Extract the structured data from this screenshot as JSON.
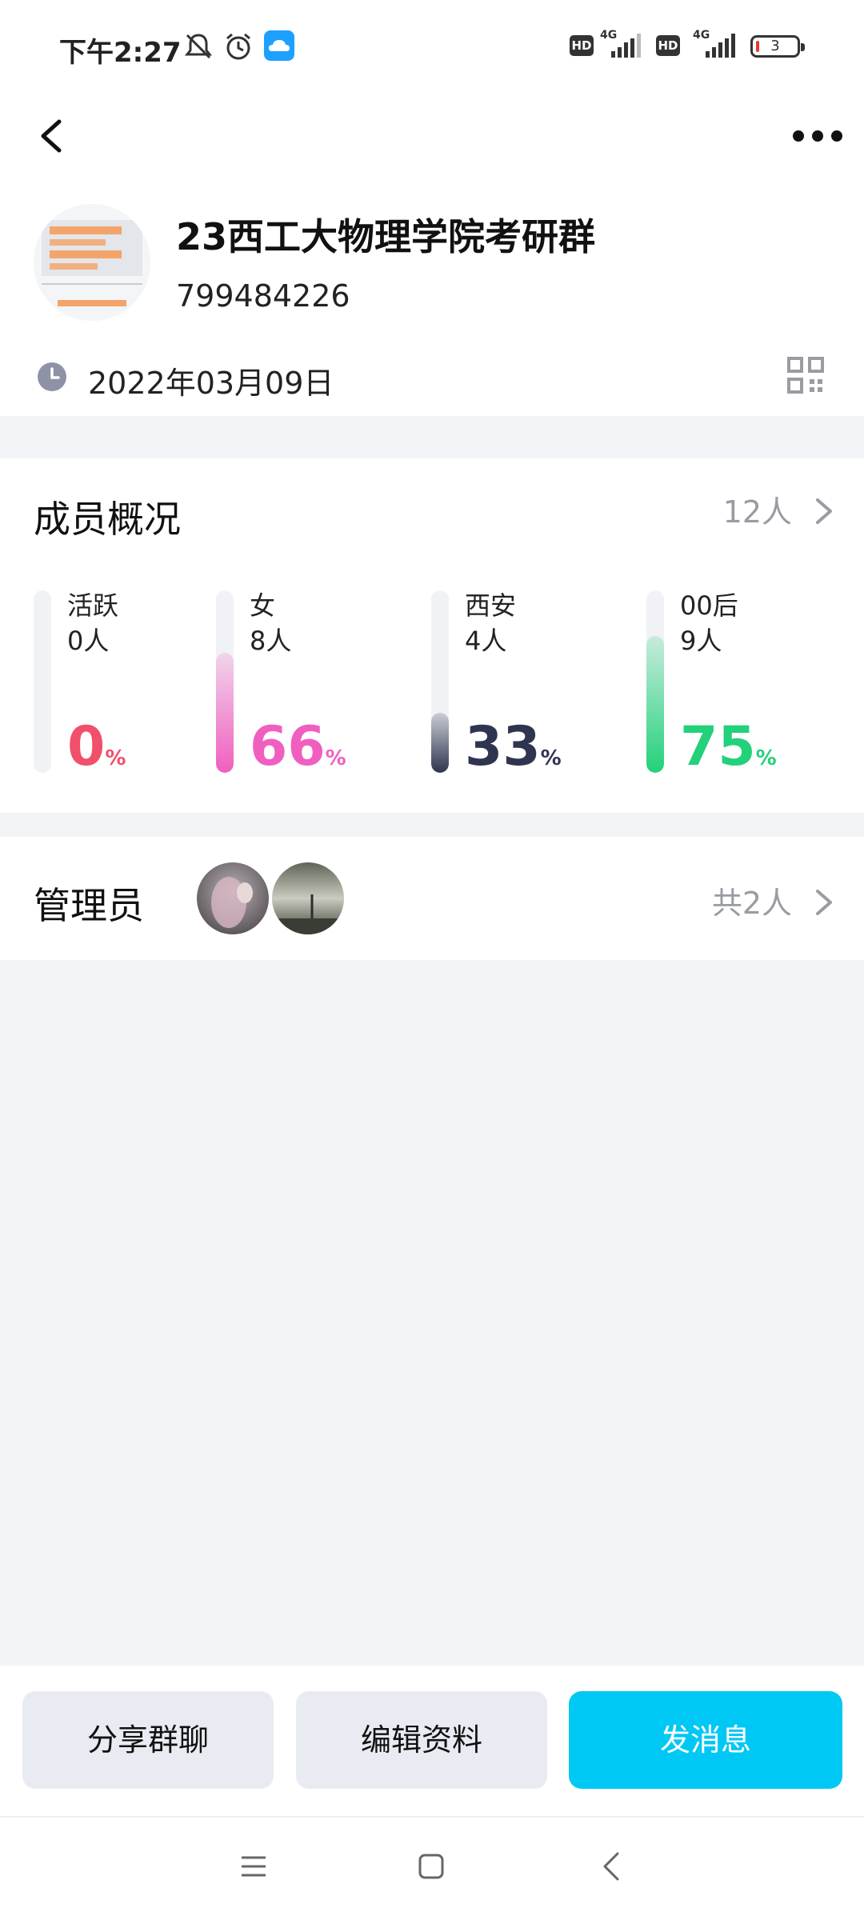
{
  "status_bar": {
    "time": "下午2:27",
    "battery": "3",
    "hd_label": "HD",
    "network_label": "4G"
  },
  "group": {
    "name": "23西工大物理学院考研群",
    "id": "799484226",
    "created_date": "2022年03月09日"
  },
  "members": {
    "title": "成员概况",
    "count_label": "12人",
    "stats": [
      {
        "label": "活跃",
        "count": "0人",
        "percent": "0",
        "percent_sign": "%",
        "level": 0.0,
        "color": "#f0506a"
      },
      {
        "label": "女",
        "count": "8人",
        "percent": "66",
        "percent_sign": "%",
        "level": 0.66,
        "color": "#f05fbf"
      },
      {
        "label": "西安",
        "count": "4人",
        "percent": "33",
        "percent_sign": "%",
        "level": 0.33,
        "color": "#2f3550"
      },
      {
        "label": "00后",
        "count": "9人",
        "percent": "75",
        "percent_sign": "%",
        "level": 0.75,
        "color": "#22d17a"
      }
    ]
  },
  "admins": {
    "title": "管理员",
    "count_label": "共2人"
  },
  "actions": {
    "share": "分享群聊",
    "edit": "编辑资料",
    "message": "发消息"
  },
  "icons": [
    "back-icon",
    "more-icon",
    "clock-icon",
    "qr-code-icon",
    "chevron-right-icon",
    "mute-icon",
    "alarm-icon",
    "cloud-icon",
    "menu-icon",
    "home-icon",
    "nav-back-icon"
  ]
}
